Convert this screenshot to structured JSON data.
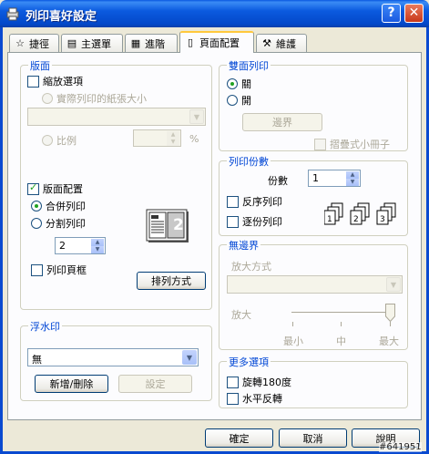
{
  "window": {
    "title": "列印喜好設定",
    "help_label": "?",
    "close_label": "✕"
  },
  "tabs": [
    {
      "label": "捷徑",
      "icon": "star-icon"
    },
    {
      "label": "主選單",
      "icon": "printer-icon"
    },
    {
      "label": "進階",
      "icon": "advanced-icon"
    },
    {
      "label": "頁面配置",
      "icon": "page-icon"
    },
    {
      "label": "維護",
      "icon": "wrench-icon"
    }
  ],
  "layout_group": {
    "title": "版面",
    "scale_option": "縮放選項",
    "actual_paper_size": "實際列印的紙張大小",
    "paper_select_value": "",
    "ratio_label": "比例",
    "ratio_value": "",
    "percent_unit": "%",
    "page_layout": "版面配置",
    "merge_print": "合併列印",
    "split_print": "分割列印",
    "pages_value": "2",
    "preview_number": "2",
    "print_border": "列印頁框",
    "arrange_button": "排列方式"
  },
  "duplex_group": {
    "title": "雙面列印",
    "off": "關",
    "on": "開",
    "margin_button": "邊界",
    "booklet": "摺疊式小冊子"
  },
  "copies_group": {
    "title": "列印份數",
    "copies_label": "份數",
    "copies_value": "1",
    "reverse_order": "反序列印",
    "collate": "逐份列印"
  },
  "borderless_group": {
    "title": "無邊界",
    "enlarge_method": "放大方式",
    "enlarge_select_value": "",
    "enlarge_label": "放大",
    "slider_min": "最小",
    "slider_mid": "中",
    "slider_max": "最大",
    "slider_level": "max"
  },
  "watermark_group": {
    "title": "浮水印",
    "select_value": "無",
    "add_delete_button": "新增/刪除",
    "settings_button": "設定"
  },
  "more_options_group": {
    "title": "更多選項",
    "rotate_180": "旋轉180度",
    "mirror": "水平反轉"
  },
  "footer": {
    "ok_button": "確定",
    "cancel_button": "取消",
    "help_button": "說明",
    "watermark_tag": "#641951"
  },
  "colors": {
    "title_bar": "#0A58E0",
    "group_title": "#0046D5",
    "check_green": "#21A121"
  }
}
